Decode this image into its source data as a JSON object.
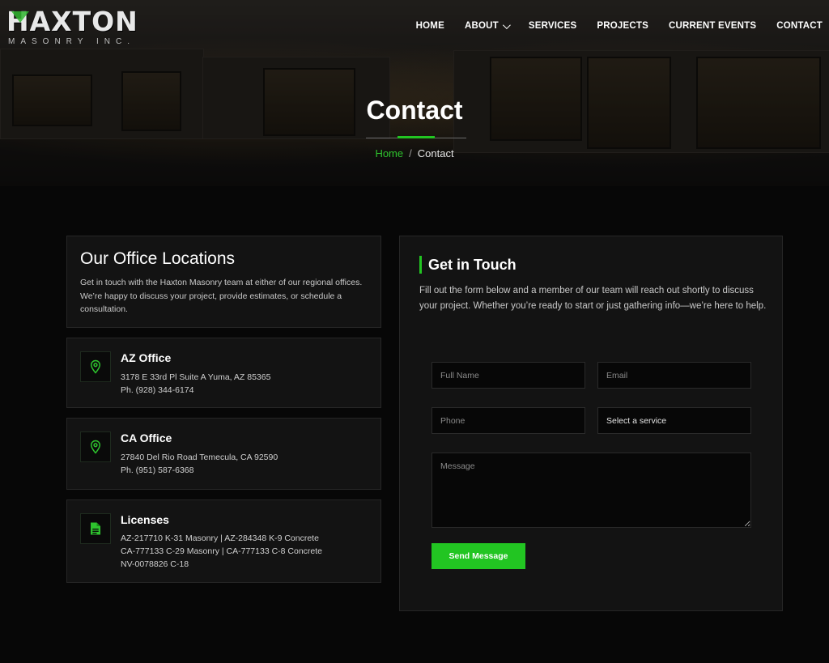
{
  "brand": {
    "logo_main": "HAXTON",
    "logo_sub": "MASONRY INC."
  },
  "nav": {
    "items": [
      {
        "label": "HOME"
      },
      {
        "label": "ABOUT"
      },
      {
        "label": "SERVICES"
      },
      {
        "label": "PROJECTS"
      },
      {
        "label": "CURRENT EVENTS"
      },
      {
        "label": "CONTACT"
      }
    ]
  },
  "hero": {
    "title": "Contact",
    "breadcrumb_home": "Home",
    "breadcrumb_sep": "/",
    "breadcrumb_current": "Contact"
  },
  "locations": {
    "title": "Our Office Locations",
    "intro": "Get in touch with the Haxton Masonry team at either of our regional offices. We’re happy to discuss your project, provide estimates, or schedule a consultation.",
    "offices": [
      {
        "name": "AZ Office",
        "lines": [
          "3178 E 33rd Pl Suite A Yuma, AZ 85365",
          "Ph. (928) 344-6174"
        ],
        "icon": "map-pin-icon"
      },
      {
        "name": "CA Office",
        "lines": [
          "27840 Del Rio Road Temecula, CA 92590",
          "Ph. (951) 587-6368"
        ],
        "icon": "map-pin-icon"
      },
      {
        "name": "Licenses",
        "lines": [
          "AZ-217710 K-31 Masonry | AZ-284348 K-9 Concrete",
          "CA-777133 C-29 Masonry | CA-777133 C-8 Concrete",
          "NV-0078826 C-18"
        ],
        "icon": "document-icon"
      }
    ]
  },
  "form": {
    "title": "Get in Touch",
    "description": "Fill out the form below and a member of our team will reach out shortly to discuss your project. Whether you’re ready to start or just gathering info—we’re here to help.",
    "full_name_placeholder": "Full Name",
    "email_placeholder": "Email",
    "phone_placeholder": "Phone",
    "service_selected": "Select a service",
    "message_placeholder": "Message",
    "submit_label": "Send Message"
  },
  "colors": {
    "accent": "#22c522",
    "background": "#070707",
    "card": "#131313"
  }
}
